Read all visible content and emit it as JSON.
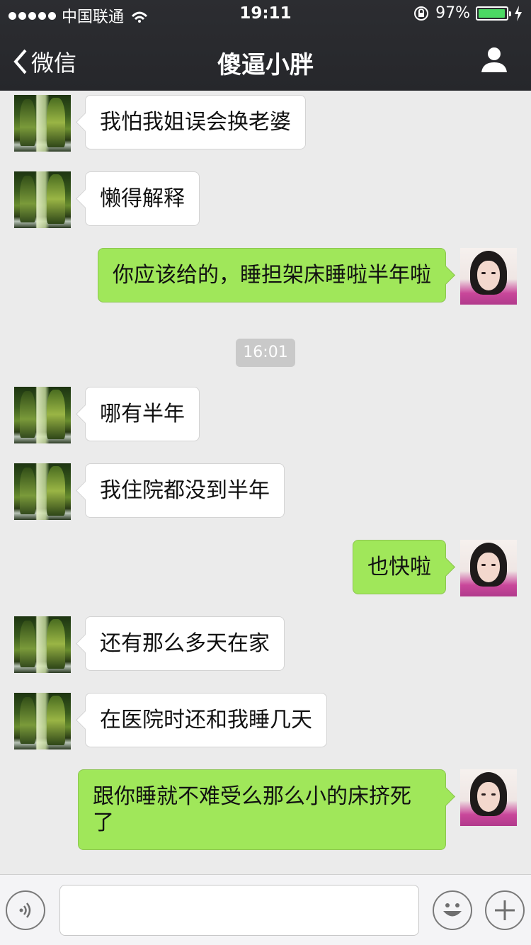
{
  "status_bar": {
    "carrier": "中国联通",
    "time": "19:11",
    "battery_percent": "97%",
    "battery_level": 0.97
  },
  "nav": {
    "back_label": "微信",
    "title": "傻逼小胖"
  },
  "messages": [
    {
      "sender": "friend",
      "text": "我怕我姐误会换老婆"
    },
    {
      "sender": "friend",
      "text": "懒得解释"
    },
    {
      "sender": "me",
      "text": "你应该给的，睡担架床睡啦半年啦"
    },
    {
      "sender": "friend",
      "text": "哪有半年"
    },
    {
      "sender": "friend",
      "text": "我住院都没到半年"
    },
    {
      "sender": "me",
      "text": "也快啦"
    },
    {
      "sender": "friend",
      "text": "还有那么多天在家"
    },
    {
      "sender": "friend",
      "text": "在医院时还和我睡几天"
    },
    {
      "sender": "me",
      "text": "跟你睡就不难受么那么小的床挤死了"
    }
  ],
  "timestamp_label": "16:01",
  "input": {
    "placeholder": ""
  },
  "colors": {
    "nav_bg": "#26272b",
    "chat_bg": "#ebebeb",
    "bubble_me": "#a0e75a",
    "bubble_friend": "#ffffff",
    "battery_fill": "#4cd964"
  },
  "icons": {
    "back": "chevron-left-icon",
    "profile": "person-icon",
    "voice": "voice-icon",
    "emoji": "emoji-icon",
    "plus": "plus-icon",
    "wifi": "wifi-icon",
    "lock": "rotation-lock-icon",
    "charge": "charging-icon"
  }
}
